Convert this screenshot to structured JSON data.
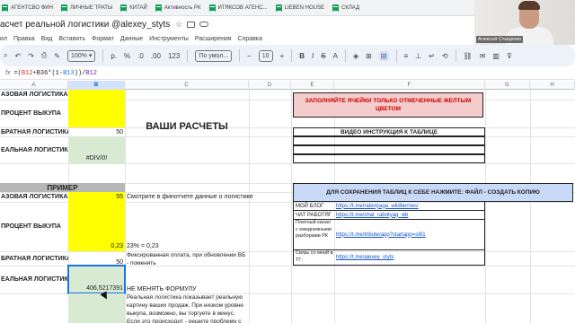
{
  "bookmarks": [
    {
      "label": "АГЕНТСВО ФИН"
    },
    {
      "label": "ЛИЧНЫЕ ТРАТЫ"
    },
    {
      "label": "КИТАЙ"
    },
    {
      "label": "Активность РК"
    },
    {
      "label": "ИТЯКСОВ АГЕНС..."
    },
    {
      "label": "LIEBEN HOUSE"
    },
    {
      "label": "СКЛАД"
    }
  ],
  "doc": {
    "title": "асчет реальной логистики @alexey_styts"
  },
  "menu": [
    "ил",
    "Правка",
    "Вид",
    "Вставить",
    "Формат",
    "Данные",
    "Инструменты",
    "Расширения",
    "Справка"
  ],
  "toolbar": {
    "currency": "р.",
    "percent": "%",
    "dec_less": ".0",
    "dec_more": ".00",
    "more_formats": "123",
    "font": "По умол...",
    "font_size": "10",
    "bold": "B",
    "italic": "I",
    "strike": "S",
    "text_color": "A"
  },
  "formula_bar": {
    "fx": "fx",
    "prefix": "=(",
    "ref1": "B12",
    "mid1": "+B36*(1-",
    "ref2": "B13",
    "mid2": "))/",
    "ref3": "B12"
  },
  "columns": [
    "A",
    "B",
    "C",
    "D",
    "E",
    "F",
    "G",
    "H"
  ],
  "sheet": {
    "a_azova": "АЗОВАЯ ЛОГИСТИКА",
    "a_procent": "ПРОЦЕНТ ВЫКУПА",
    "a_obratnaya": "БРАТНАЯ ЛОГИСТИКА",
    "b_obratnaya": "50",
    "a_realnaya": "ЕАЛЬНАЯ ЛОГИСТИКА",
    "b_realnaya": "#DIV/0!",
    "vashi_raschety": "ВАШИ РАСЧЕТЫ",
    "primer": "ПРИМЕР",
    "a_azova2": "АЗОВАЯ ЛОГИСТИКА",
    "b_azova2": "55",
    "c_azova2": "Смотрите в финотчете данные о логистике",
    "a_procent2": "ПРОЦЕНТ ВЫКУПА",
    "b_procent2": "0,23",
    "c_procent2": "23% = 0,23",
    "a_obratnaya2": "БРАТНАЯ ЛОГИСТИКА",
    "b_obratnaya2": "50",
    "c_obratnaya2": "Фиксированная оплата, при обновлении ВБ - поменять",
    "a_realnaya2": "ЕАЛЬНАЯ ЛОГИСТИКА",
    "b_realnaya2": "406,5217391",
    "c_realnaya2": "НЕ МЕНЯТЬ ФОРМУЛУ",
    "c_note": "Реальная логистика показывает реальную картину ваших продаж. При низком уровне выкупа, возможно, вы торгуете в минус. Если это происходит - решите проблему с",
    "pink_notice": "ЗАПОЛНЯЙТЕ ЯЧЕЙКИ ТОЛЬКО ОТМЕЧЕННЫЕ ЖЕЛТЫМ ЦВЕТОМ",
    "video_header": "ВИДЕО ИНСТРУКЦИЯ К ТАБЛИЦЕ",
    "save_header": "ДЛЯ СОХРАНЕНИЯ ТАБЛИЦ К СЕБЕ НАЖМИТЕ: ФАЙЛ - СОЗДАТЬ КОПИЮ",
    "links": [
      {
        "label": "МОЙ БЛОГ",
        "url": "https://t.me/rabotyaga_wildberries/"
      },
      {
        "label": "ЧАТ РАБОТЯГ",
        "url": "https://t.me/chat_rabotyag_wb"
      },
      {
        "label": "Платный канал с ежедневными разборами РК",
        "url": "https://t.me/tribute/app?startapp=sI81"
      },
      {
        "label": "Связь со мной в ТГ:",
        "url": "https://t.me/alexey_styts"
      }
    ]
  },
  "webcam": {
    "name": "Алексей Стыценко"
  },
  "colors": {
    "yellow": "#ffff00",
    "green": "#d9ead3",
    "pink": "#f4cccc",
    "blue": "#c9daf8",
    "gray": "#b7b7b7"
  }
}
